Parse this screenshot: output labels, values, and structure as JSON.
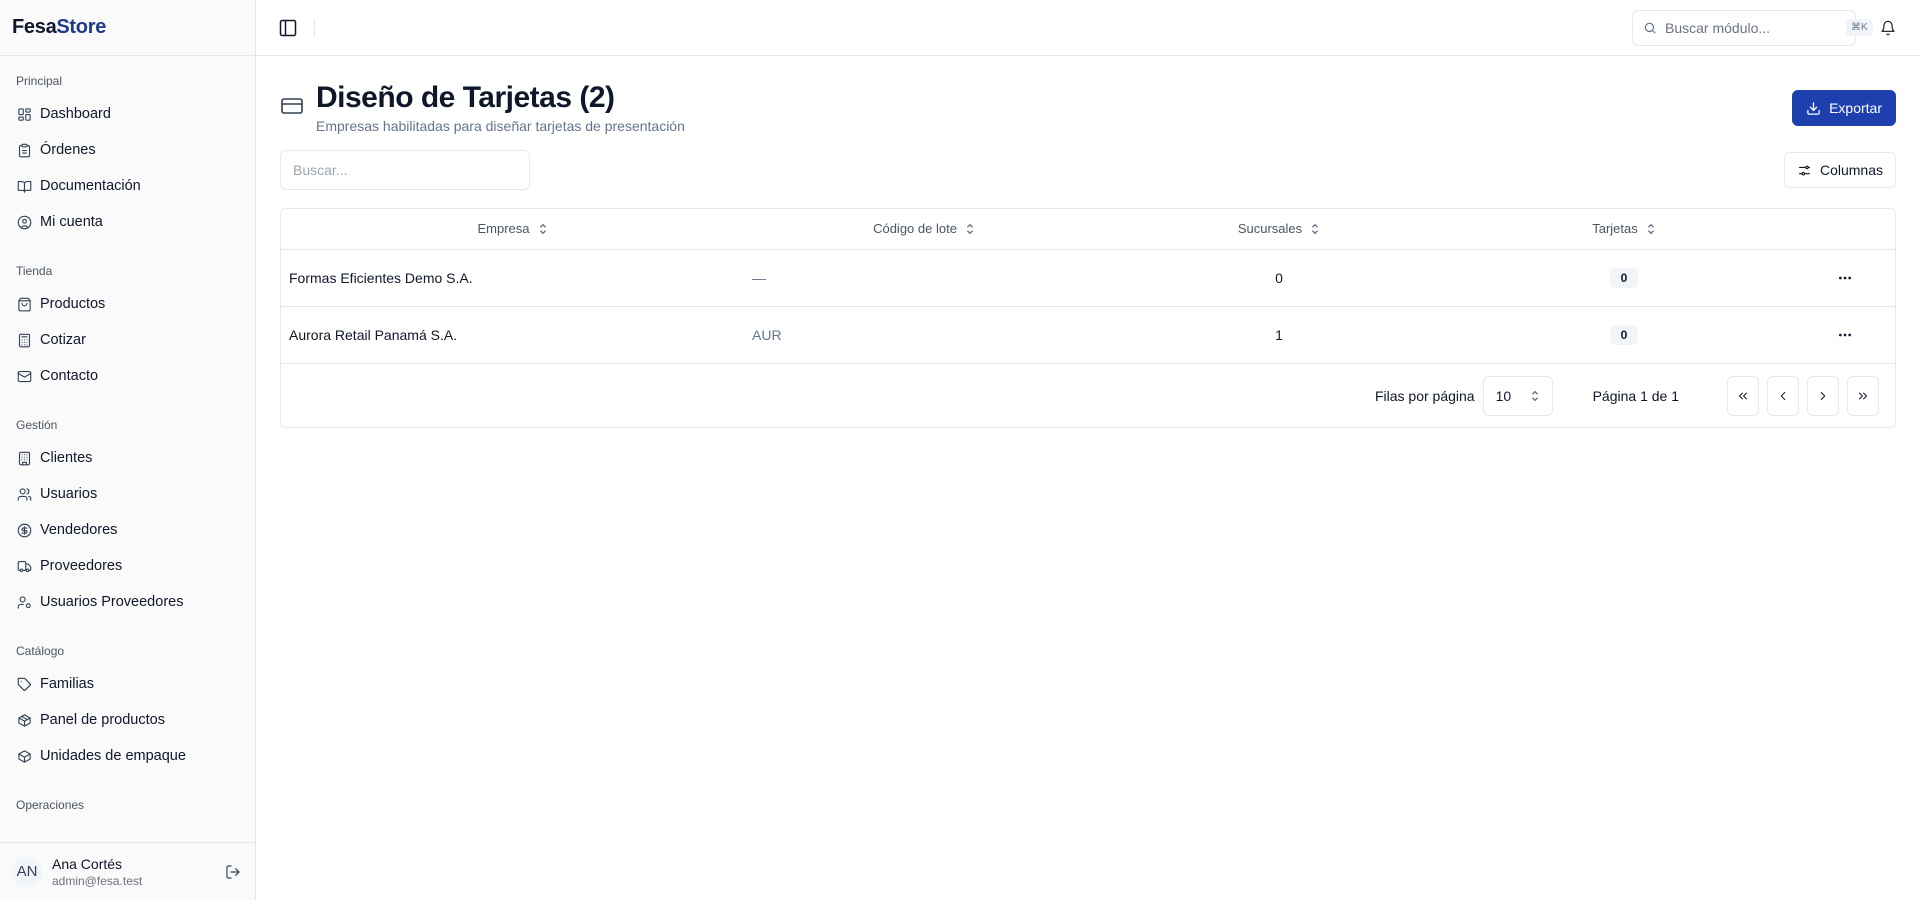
{
  "brand": {
    "part1": "Fesa",
    "part2": "Store"
  },
  "sidebar": {
    "groups": [
      {
        "label": "Principal",
        "items": [
          {
            "label": "Dashboard",
            "icon": "dashboard-icon"
          },
          {
            "label": "Órdenes",
            "icon": "clipboard-icon"
          },
          {
            "label": "Documentación",
            "icon": "book-icon"
          },
          {
            "label": "Mi cuenta",
            "icon": "user-circle-icon"
          }
        ]
      },
      {
        "label": "Tienda",
        "items": [
          {
            "label": "Productos",
            "icon": "shopping-bag-icon"
          },
          {
            "label": "Cotizar",
            "icon": "calculator-icon"
          },
          {
            "label": "Contacto",
            "icon": "mail-icon"
          }
        ]
      },
      {
        "label": "Gestión",
        "items": [
          {
            "label": "Clientes",
            "icon": "building-icon"
          },
          {
            "label": "Usuarios",
            "icon": "users-icon"
          },
          {
            "label": "Vendedores",
            "icon": "dollar-circle-icon"
          },
          {
            "label": "Proveedores",
            "icon": "truck-icon"
          },
          {
            "label": "Usuarios Proveedores",
            "icon": "user-cog-icon"
          }
        ]
      },
      {
        "label": "Catálogo",
        "items": [
          {
            "label": "Familias",
            "icon": "tags-icon"
          },
          {
            "label": "Panel de productos",
            "icon": "package-icon"
          },
          {
            "label": "Unidades de empaque",
            "icon": "box-icon"
          }
        ]
      },
      {
        "label": "Operaciones",
        "items": []
      }
    ]
  },
  "user": {
    "initials": "AN",
    "name": "Ana Cortés",
    "email": "admin@fesa.test"
  },
  "topbar": {
    "search_placeholder": "Buscar módulo...",
    "shortcut": "⌘K"
  },
  "page": {
    "title": "Diseño de Tarjetas (2)",
    "subtitle": "Empresas habilitadas para diseñar tarjetas de presentación",
    "export_label": "Exportar",
    "filter_placeholder": "Buscar...",
    "columns_label": "Columnas"
  },
  "table": {
    "headers": {
      "company": "Empresa",
      "lot": "Código de lote",
      "branches": "Sucursales",
      "cards": "Tarjetas"
    },
    "rows": [
      {
        "company": "Formas Eficientes Demo S.A.",
        "lot": "—",
        "branches": "0",
        "cards": "0"
      },
      {
        "company": "Aurora Retail Panamá S.A.",
        "lot": "AUR",
        "branches": "1",
        "cards": "0"
      }
    ]
  },
  "pagination": {
    "rows_label": "Filas por página",
    "rows_value": "10",
    "page_info": "Página 1 de 1"
  },
  "colors": {
    "brand_accent": "#1e3a8a",
    "primary_button": "#1e40af"
  }
}
